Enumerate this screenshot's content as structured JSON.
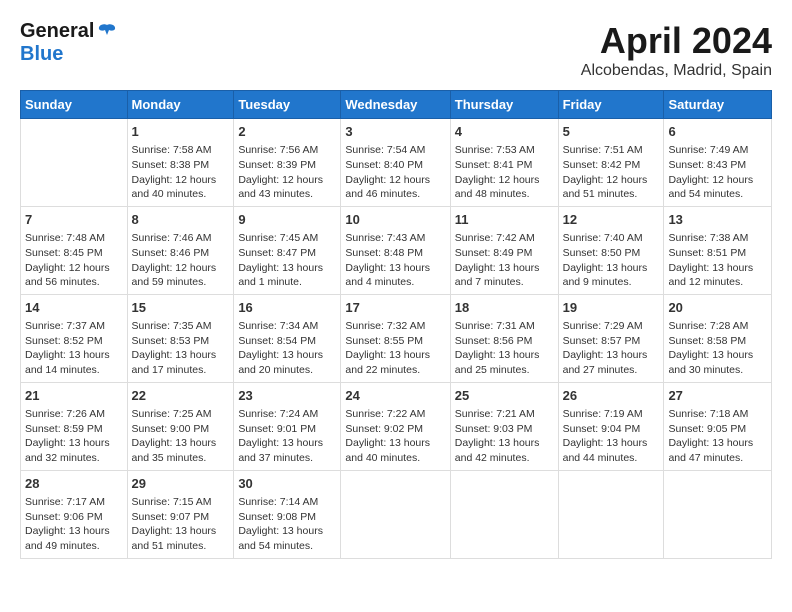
{
  "logo": {
    "general": "General",
    "blue": "Blue"
  },
  "title": "April 2024",
  "subtitle": "Alcobendas, Madrid, Spain",
  "days_header": [
    "Sunday",
    "Monday",
    "Tuesday",
    "Wednesday",
    "Thursday",
    "Friday",
    "Saturday"
  ],
  "weeks": [
    [
      {
        "num": "",
        "sunrise": "",
        "sunset": "",
        "daylight": ""
      },
      {
        "num": "1",
        "sunrise": "Sunrise: 7:58 AM",
        "sunset": "Sunset: 8:38 PM",
        "daylight": "Daylight: 12 hours and 40 minutes."
      },
      {
        "num": "2",
        "sunrise": "Sunrise: 7:56 AM",
        "sunset": "Sunset: 8:39 PM",
        "daylight": "Daylight: 12 hours and 43 minutes."
      },
      {
        "num": "3",
        "sunrise": "Sunrise: 7:54 AM",
        "sunset": "Sunset: 8:40 PM",
        "daylight": "Daylight: 12 hours and 46 minutes."
      },
      {
        "num": "4",
        "sunrise": "Sunrise: 7:53 AM",
        "sunset": "Sunset: 8:41 PM",
        "daylight": "Daylight: 12 hours and 48 minutes."
      },
      {
        "num": "5",
        "sunrise": "Sunrise: 7:51 AM",
        "sunset": "Sunset: 8:42 PM",
        "daylight": "Daylight: 12 hours and 51 minutes."
      },
      {
        "num": "6",
        "sunrise": "Sunrise: 7:49 AM",
        "sunset": "Sunset: 8:43 PM",
        "daylight": "Daylight: 12 hours and 54 minutes."
      }
    ],
    [
      {
        "num": "7",
        "sunrise": "Sunrise: 7:48 AM",
        "sunset": "Sunset: 8:45 PM",
        "daylight": "Daylight: 12 hours and 56 minutes."
      },
      {
        "num": "8",
        "sunrise": "Sunrise: 7:46 AM",
        "sunset": "Sunset: 8:46 PM",
        "daylight": "Daylight: 12 hours and 59 minutes."
      },
      {
        "num": "9",
        "sunrise": "Sunrise: 7:45 AM",
        "sunset": "Sunset: 8:47 PM",
        "daylight": "Daylight: 13 hours and 1 minute."
      },
      {
        "num": "10",
        "sunrise": "Sunrise: 7:43 AM",
        "sunset": "Sunset: 8:48 PM",
        "daylight": "Daylight: 13 hours and 4 minutes."
      },
      {
        "num": "11",
        "sunrise": "Sunrise: 7:42 AM",
        "sunset": "Sunset: 8:49 PM",
        "daylight": "Daylight: 13 hours and 7 minutes."
      },
      {
        "num": "12",
        "sunrise": "Sunrise: 7:40 AM",
        "sunset": "Sunset: 8:50 PM",
        "daylight": "Daylight: 13 hours and 9 minutes."
      },
      {
        "num": "13",
        "sunrise": "Sunrise: 7:38 AM",
        "sunset": "Sunset: 8:51 PM",
        "daylight": "Daylight: 13 hours and 12 minutes."
      }
    ],
    [
      {
        "num": "14",
        "sunrise": "Sunrise: 7:37 AM",
        "sunset": "Sunset: 8:52 PM",
        "daylight": "Daylight: 13 hours and 14 minutes."
      },
      {
        "num": "15",
        "sunrise": "Sunrise: 7:35 AM",
        "sunset": "Sunset: 8:53 PM",
        "daylight": "Daylight: 13 hours and 17 minutes."
      },
      {
        "num": "16",
        "sunrise": "Sunrise: 7:34 AM",
        "sunset": "Sunset: 8:54 PM",
        "daylight": "Daylight: 13 hours and 20 minutes."
      },
      {
        "num": "17",
        "sunrise": "Sunrise: 7:32 AM",
        "sunset": "Sunset: 8:55 PM",
        "daylight": "Daylight: 13 hours and 22 minutes."
      },
      {
        "num": "18",
        "sunrise": "Sunrise: 7:31 AM",
        "sunset": "Sunset: 8:56 PM",
        "daylight": "Daylight: 13 hours and 25 minutes."
      },
      {
        "num": "19",
        "sunrise": "Sunrise: 7:29 AM",
        "sunset": "Sunset: 8:57 PM",
        "daylight": "Daylight: 13 hours and 27 minutes."
      },
      {
        "num": "20",
        "sunrise": "Sunrise: 7:28 AM",
        "sunset": "Sunset: 8:58 PM",
        "daylight": "Daylight: 13 hours and 30 minutes."
      }
    ],
    [
      {
        "num": "21",
        "sunrise": "Sunrise: 7:26 AM",
        "sunset": "Sunset: 8:59 PM",
        "daylight": "Daylight: 13 hours and 32 minutes."
      },
      {
        "num": "22",
        "sunrise": "Sunrise: 7:25 AM",
        "sunset": "Sunset: 9:00 PM",
        "daylight": "Daylight: 13 hours and 35 minutes."
      },
      {
        "num": "23",
        "sunrise": "Sunrise: 7:24 AM",
        "sunset": "Sunset: 9:01 PM",
        "daylight": "Daylight: 13 hours and 37 minutes."
      },
      {
        "num": "24",
        "sunrise": "Sunrise: 7:22 AM",
        "sunset": "Sunset: 9:02 PM",
        "daylight": "Daylight: 13 hours and 40 minutes."
      },
      {
        "num": "25",
        "sunrise": "Sunrise: 7:21 AM",
        "sunset": "Sunset: 9:03 PM",
        "daylight": "Daylight: 13 hours and 42 minutes."
      },
      {
        "num": "26",
        "sunrise": "Sunrise: 7:19 AM",
        "sunset": "Sunset: 9:04 PM",
        "daylight": "Daylight: 13 hours and 44 minutes."
      },
      {
        "num": "27",
        "sunrise": "Sunrise: 7:18 AM",
        "sunset": "Sunset: 9:05 PM",
        "daylight": "Daylight: 13 hours and 47 minutes."
      }
    ],
    [
      {
        "num": "28",
        "sunrise": "Sunrise: 7:17 AM",
        "sunset": "Sunset: 9:06 PM",
        "daylight": "Daylight: 13 hours and 49 minutes."
      },
      {
        "num": "29",
        "sunrise": "Sunrise: 7:15 AM",
        "sunset": "Sunset: 9:07 PM",
        "daylight": "Daylight: 13 hours and 51 minutes."
      },
      {
        "num": "30",
        "sunrise": "Sunrise: 7:14 AM",
        "sunset": "Sunset: 9:08 PM",
        "daylight": "Daylight: 13 hours and 54 minutes."
      },
      {
        "num": "",
        "sunrise": "",
        "sunset": "",
        "daylight": ""
      },
      {
        "num": "",
        "sunrise": "",
        "sunset": "",
        "daylight": ""
      },
      {
        "num": "",
        "sunrise": "",
        "sunset": "",
        "daylight": ""
      },
      {
        "num": "",
        "sunrise": "",
        "sunset": "",
        "daylight": ""
      }
    ]
  ]
}
